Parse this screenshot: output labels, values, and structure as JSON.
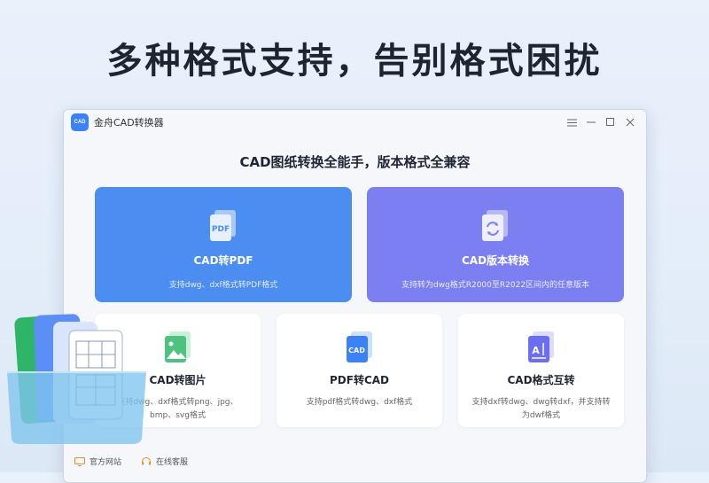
{
  "headline": "多种格式支持，告别格式困扰",
  "window": {
    "app_title": "金舟CAD转换器",
    "logo_text": "CAD"
  },
  "main_title": "CAD图纸转换全能手，版本格式全兼容",
  "cards": {
    "pdf": {
      "icon_text": "PDF",
      "title": "CAD转PDF",
      "desc": "支持dwg、dxf格式转PDF格式"
    },
    "version": {
      "title": "CAD版本转换",
      "desc": "支持转为dwg格式R2000至R2022区间内的任意版本"
    },
    "image": {
      "title": "CAD转图片",
      "desc": "支持dwg、dxf格式转png、jpg、bmp、svg格式"
    },
    "pdf_to_cad": {
      "icon_text": "CAD",
      "title": "PDF转CAD",
      "desc": "支持pdf格式转dwg、dxf格式"
    },
    "format": {
      "icon_text": "A",
      "title": "CAD格式互转",
      "desc": "支持dxf转dwg、dwg转dxf，并支持转为dwf格式"
    }
  },
  "footer": {
    "website": "官方网站",
    "service": "在线客服"
  },
  "colors": {
    "pdf_card": "#4b8df0",
    "version_card": "#7b7ff2",
    "accent": "#3b82f6"
  }
}
